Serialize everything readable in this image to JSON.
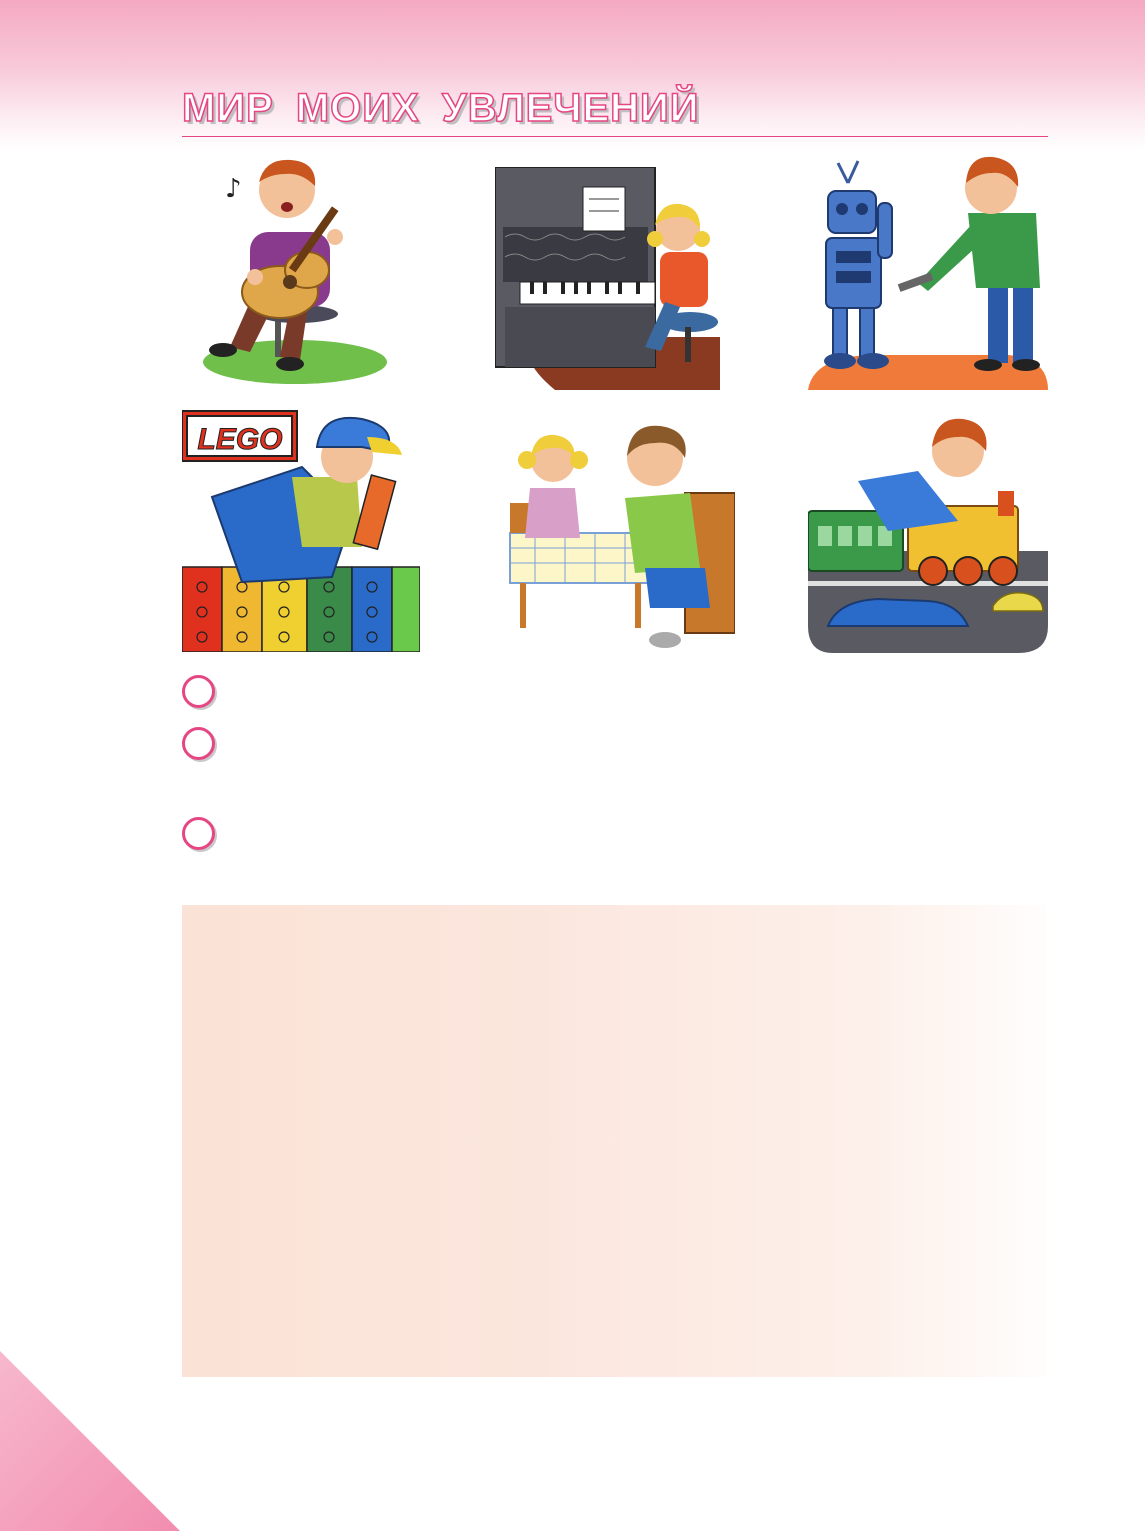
{
  "page": {
    "title": "МИР МОИХ УВЛЕЧЕНИЙ",
    "accent_color": "#e74684",
    "band_color": "#f4a9c2",
    "answer_box_color": "#fbe2d6"
  },
  "illustrations": [
    {
      "name": "boy-playing-guitar-illustration",
      "icon": "guitar-icon"
    },
    {
      "name": "girl-playing-piano-illustration",
      "icon": "piano-icon"
    },
    {
      "name": "boy-building-robot-illustration",
      "icon": "robot-icon"
    },
    {
      "name": "boy-building-lego-illustration",
      "icon": "lego-icon",
      "logo_text": "LEGO"
    },
    {
      "name": "children-drawing-at-table-illustration",
      "icon": "paintbrush-icon"
    },
    {
      "name": "boy-with-toy-train-and-cars-illustration",
      "icon": "train-icon"
    }
  ],
  "markers": [
    {
      "icon": "circle-marker-icon"
    },
    {
      "icon": "circle-marker-icon"
    },
    {
      "icon": "circle-marker-icon"
    }
  ]
}
